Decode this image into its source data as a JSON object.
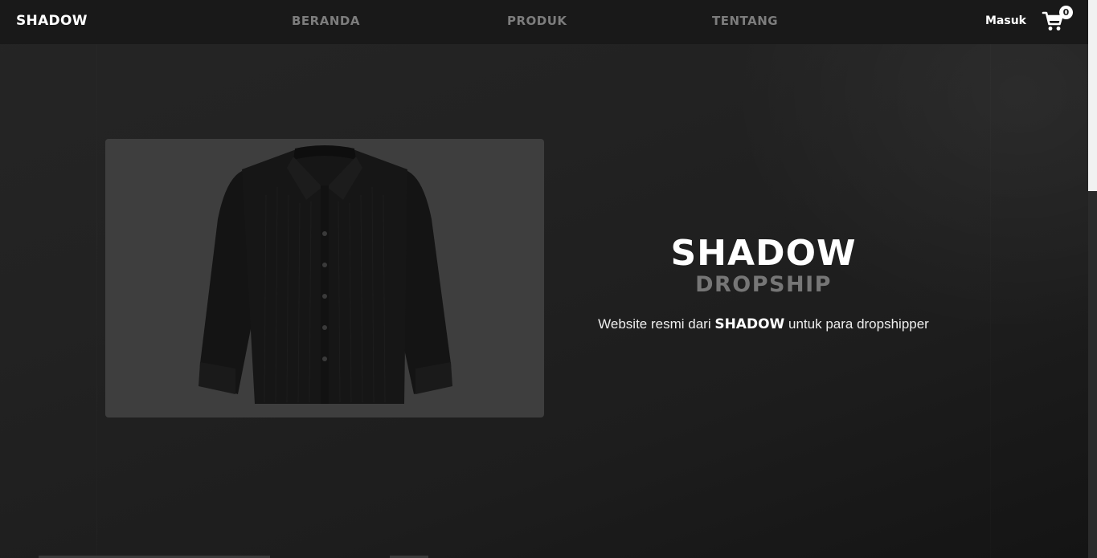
{
  "navbar": {
    "brand": "SHADOW",
    "links": [
      {
        "label": "BERANDA"
      },
      {
        "label": "PRODUK"
      },
      {
        "label": "TENTANG"
      }
    ],
    "login_label": "Masuk",
    "cart_icon": "cart-icon",
    "cart_count": "0"
  },
  "hero": {
    "image_alt": "black corduroy long-sleeve shirt",
    "title": "SHADOW",
    "subtitle": "DROPSHIP",
    "description_prefix": "Website resmi dari ",
    "description_brand": "SHADOW",
    "description_suffix": " untuk para dropshipper"
  },
  "colors": {
    "background": "#1f1f1f",
    "navbar": "#191919",
    "nav_link": "#7d7d7d",
    "subtitle": "#767676",
    "image_panel": "#3e3e3e",
    "text": "#ffffff"
  }
}
